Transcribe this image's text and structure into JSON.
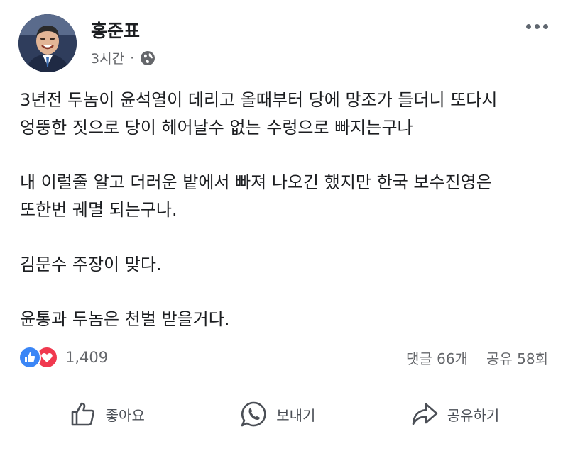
{
  "post": {
    "author": {
      "name": "홍준표",
      "avatar_icon": "profile-photo"
    },
    "timestamp": "3시간",
    "separator": "·",
    "privacy_icon": "globe-icon",
    "more_icon": "more-horizontal-icon",
    "paragraphs": [
      "3년전 두놈이 윤석열이 데리고 올때부터 당에 망조가 들더니 또다시\n엉뚱한 짓으로 당이 헤어날수 없는 수렁으로 빠지는구나",
      "내 이럴줄 알고  더러운 밭에서  빠져 나오긴 했지만 한국 보수진영은\n또한번 궤멸 되는구나.",
      "김문수 주장이 맞다.",
      "윤통과 두놈은 천벌 받을거다."
    ],
    "reactions": {
      "icons": [
        "like-icon",
        "love-icon"
      ],
      "count": "1,409"
    },
    "stats": {
      "comments": "댓글 66개",
      "shares": "공유 58회"
    },
    "actions": {
      "like": "좋아요",
      "send": "보내기",
      "share": "공유하기"
    },
    "colors": {
      "like_blue": "#3b86f6",
      "love_red": "#f0394f",
      "secondary_text": "#65676b"
    }
  }
}
